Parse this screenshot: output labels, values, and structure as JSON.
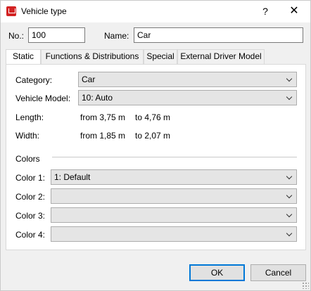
{
  "window": {
    "title": "Vehicle type",
    "help": "?",
    "close": "✕"
  },
  "header": {
    "no_label": "No.:",
    "no_value": "100",
    "name_label": "Name:",
    "name_value": "Car"
  },
  "tabs": [
    {
      "label": "Static",
      "active": true
    },
    {
      "label": "Functions & Distributions",
      "active": false
    },
    {
      "label": "Special",
      "active": false
    },
    {
      "label": "External Driver Model",
      "active": false
    }
  ],
  "static": {
    "category_label": "Category:",
    "category_value": "Car",
    "model_label": "Vehicle Model:",
    "model_value": "10: Auto",
    "length_label": "Length:",
    "length_from": "from 3,75 m",
    "length_to": "to 4,76 m",
    "width_label": "Width:",
    "width_from": "from 1,85 m",
    "width_to": "to 2,07 m",
    "colors_heading": "Colors",
    "colors": [
      {
        "label": "Color 1:",
        "value": "1: Default"
      },
      {
        "label": "Color 2:",
        "value": ""
      },
      {
        "label": "Color 3:",
        "value": ""
      },
      {
        "label": "Color 4:",
        "value": ""
      }
    ]
  },
  "footer": {
    "ok": "OK",
    "cancel": "Cancel"
  }
}
